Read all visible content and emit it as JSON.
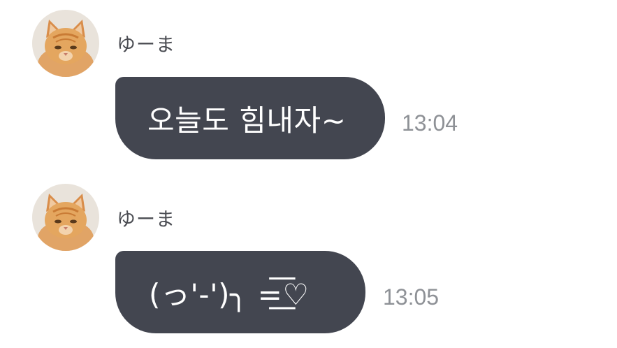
{
  "messages": [
    {
      "sender": "ゆーま",
      "avatar_icon": "cat-avatar",
      "text": "오늘도 힘내자~",
      "time": "13:04"
    },
    {
      "sender": "ゆーま",
      "avatar_icon": "cat-avatar",
      "text": "(っ'-')╮ =͟͟͞♡",
      "time": "13:05"
    }
  ],
  "colors": {
    "bubble": "#434650",
    "bubble_text": "#ffffff",
    "time": "#8e9196",
    "sender": "#4a4c52"
  }
}
